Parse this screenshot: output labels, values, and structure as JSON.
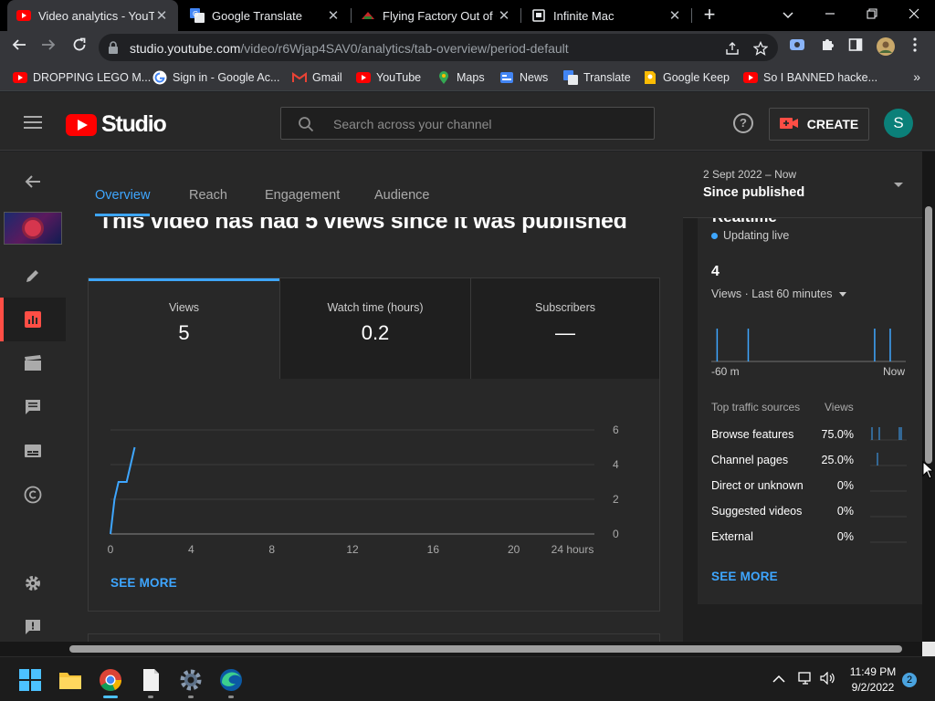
{
  "browser": {
    "tabs": [
      {
        "title": "Video analytics - YouTube Studio",
        "close": "✕"
      },
      {
        "title": "Google Translate",
        "close": "✕"
      },
      {
        "title": "Flying Factory Out of Control",
        "close": "✕"
      },
      {
        "title": "Infinite Mac",
        "close": "✕"
      }
    ],
    "new_tab": "+",
    "url_host": "studio.youtube.com",
    "url_path": "/video/r6Wjap4SAV0/analytics/tab-overview/period-default",
    "bookmarks": [
      "DROPPING LEGO M...",
      "Sign in - Google Ac...",
      "Gmail",
      "YouTube",
      "Maps",
      "News",
      "Translate",
      "Google Keep",
      "So I BANNED hacke..."
    ],
    "bookmarks_more": "»"
  },
  "studio": {
    "logo_text": "Studio",
    "search_placeholder": "Search across your channel",
    "help": "?",
    "create_label": "CREATE",
    "avatar_letter": "S"
  },
  "analytics": {
    "tabs": [
      "Overview",
      "Reach",
      "Engagement",
      "Audience"
    ],
    "headline": "This video has had 5 views since it was published",
    "metrics": [
      {
        "label": "Views",
        "value": "5"
      },
      {
        "label": "Watch time (hours)",
        "value": "0.2"
      },
      {
        "label": "Subscribers",
        "value": "—"
      }
    ],
    "see_more": "SEE MORE"
  },
  "chart_data": {
    "type": "line",
    "title": "",
    "xlabel": "",
    "ylabel": "",
    "x_ticks": [
      "0",
      "4",
      "8",
      "12",
      "16",
      "20",
      "24 hours"
    ],
    "y_ticks": [
      "0",
      "2",
      "4",
      "6"
    ],
    "xlim": [
      0,
      24
    ],
    "ylim": [
      0,
      6
    ],
    "grid": true,
    "series": [
      {
        "color": "#3ea6ff",
        "x": [
          0,
          0.1,
          0.2,
          0.4,
          0.5,
          0.8,
          1.0,
          1.1,
          1.2
        ],
        "y": [
          0,
          1,
          2,
          3,
          3,
          3,
          4,
          4.5,
          5
        ]
      }
    ]
  },
  "period": {
    "range": "2 Sept 2022 – Now",
    "name": "Since published"
  },
  "realtime": {
    "title": "Realtime",
    "status": "Updating live",
    "count": "4",
    "subtitle": "Views · Last 60 minutes",
    "axis_start": "-60 m",
    "axis_end": "Now",
    "spikes": [
      3,
      19,
      84,
      92
    ],
    "traffic_header": "Top traffic sources",
    "traffic_col": "Views",
    "sources": [
      {
        "name": "Browse features",
        "value": "75.0%",
        "bars": [
          2,
          10,
          32,
          34
        ]
      },
      {
        "name": "Channel pages",
        "value": "25.0%",
        "bars": [
          8
        ]
      },
      {
        "name": "Direct or unknown",
        "value": "0%",
        "bars": []
      },
      {
        "name": "Suggested videos",
        "value": "0%",
        "bars": []
      },
      {
        "name": "External",
        "value": "0%",
        "bars": []
      }
    ],
    "see_more": "SEE MORE"
  },
  "taskbar": {
    "time": "11:49 PM",
    "date": "9/2/2022",
    "notifications": "2"
  },
  "colors": {
    "accent": "#3ea6ff",
    "brand_red": "#ff0000",
    "active_rail": "#ff4e45"
  }
}
